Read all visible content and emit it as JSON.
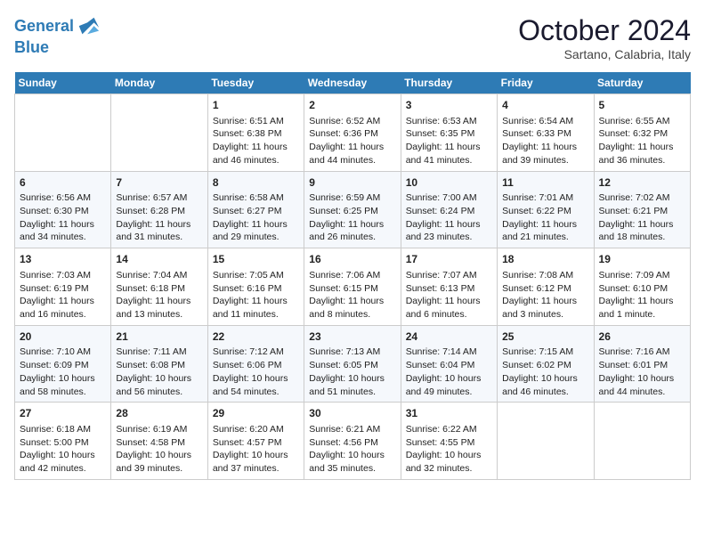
{
  "header": {
    "logo_line1": "General",
    "logo_line2": "Blue",
    "month_year": "October 2024",
    "location": "Sartano, Calabria, Italy"
  },
  "weekdays": [
    "Sunday",
    "Monday",
    "Tuesday",
    "Wednesday",
    "Thursday",
    "Friday",
    "Saturday"
  ],
  "weeks": [
    [
      {
        "day": "",
        "info": ""
      },
      {
        "day": "",
        "info": ""
      },
      {
        "day": "1",
        "info": "Sunrise: 6:51 AM\nSunset: 6:38 PM\nDaylight: 11 hours and 46 minutes."
      },
      {
        "day": "2",
        "info": "Sunrise: 6:52 AM\nSunset: 6:36 PM\nDaylight: 11 hours and 44 minutes."
      },
      {
        "day": "3",
        "info": "Sunrise: 6:53 AM\nSunset: 6:35 PM\nDaylight: 11 hours and 41 minutes."
      },
      {
        "day": "4",
        "info": "Sunrise: 6:54 AM\nSunset: 6:33 PM\nDaylight: 11 hours and 39 minutes."
      },
      {
        "day": "5",
        "info": "Sunrise: 6:55 AM\nSunset: 6:32 PM\nDaylight: 11 hours and 36 minutes."
      }
    ],
    [
      {
        "day": "6",
        "info": "Sunrise: 6:56 AM\nSunset: 6:30 PM\nDaylight: 11 hours and 34 minutes."
      },
      {
        "day": "7",
        "info": "Sunrise: 6:57 AM\nSunset: 6:28 PM\nDaylight: 11 hours and 31 minutes."
      },
      {
        "day": "8",
        "info": "Sunrise: 6:58 AM\nSunset: 6:27 PM\nDaylight: 11 hours and 29 minutes."
      },
      {
        "day": "9",
        "info": "Sunrise: 6:59 AM\nSunset: 6:25 PM\nDaylight: 11 hours and 26 minutes."
      },
      {
        "day": "10",
        "info": "Sunrise: 7:00 AM\nSunset: 6:24 PM\nDaylight: 11 hours and 23 minutes."
      },
      {
        "day": "11",
        "info": "Sunrise: 7:01 AM\nSunset: 6:22 PM\nDaylight: 11 hours and 21 minutes."
      },
      {
        "day": "12",
        "info": "Sunrise: 7:02 AM\nSunset: 6:21 PM\nDaylight: 11 hours and 18 minutes."
      }
    ],
    [
      {
        "day": "13",
        "info": "Sunrise: 7:03 AM\nSunset: 6:19 PM\nDaylight: 11 hours and 16 minutes."
      },
      {
        "day": "14",
        "info": "Sunrise: 7:04 AM\nSunset: 6:18 PM\nDaylight: 11 hours and 13 minutes."
      },
      {
        "day": "15",
        "info": "Sunrise: 7:05 AM\nSunset: 6:16 PM\nDaylight: 11 hours and 11 minutes."
      },
      {
        "day": "16",
        "info": "Sunrise: 7:06 AM\nSunset: 6:15 PM\nDaylight: 11 hours and 8 minutes."
      },
      {
        "day": "17",
        "info": "Sunrise: 7:07 AM\nSunset: 6:13 PM\nDaylight: 11 hours and 6 minutes."
      },
      {
        "day": "18",
        "info": "Sunrise: 7:08 AM\nSunset: 6:12 PM\nDaylight: 11 hours and 3 minutes."
      },
      {
        "day": "19",
        "info": "Sunrise: 7:09 AM\nSunset: 6:10 PM\nDaylight: 11 hours and 1 minute."
      }
    ],
    [
      {
        "day": "20",
        "info": "Sunrise: 7:10 AM\nSunset: 6:09 PM\nDaylight: 10 hours and 58 minutes."
      },
      {
        "day": "21",
        "info": "Sunrise: 7:11 AM\nSunset: 6:08 PM\nDaylight: 10 hours and 56 minutes."
      },
      {
        "day": "22",
        "info": "Sunrise: 7:12 AM\nSunset: 6:06 PM\nDaylight: 10 hours and 54 minutes."
      },
      {
        "day": "23",
        "info": "Sunrise: 7:13 AM\nSunset: 6:05 PM\nDaylight: 10 hours and 51 minutes."
      },
      {
        "day": "24",
        "info": "Sunrise: 7:14 AM\nSunset: 6:04 PM\nDaylight: 10 hours and 49 minutes."
      },
      {
        "day": "25",
        "info": "Sunrise: 7:15 AM\nSunset: 6:02 PM\nDaylight: 10 hours and 46 minutes."
      },
      {
        "day": "26",
        "info": "Sunrise: 7:16 AM\nSunset: 6:01 PM\nDaylight: 10 hours and 44 minutes."
      }
    ],
    [
      {
        "day": "27",
        "info": "Sunrise: 6:18 AM\nSunset: 5:00 PM\nDaylight: 10 hours and 42 minutes."
      },
      {
        "day": "28",
        "info": "Sunrise: 6:19 AM\nSunset: 4:58 PM\nDaylight: 10 hours and 39 minutes."
      },
      {
        "day": "29",
        "info": "Sunrise: 6:20 AM\nSunset: 4:57 PM\nDaylight: 10 hours and 37 minutes."
      },
      {
        "day": "30",
        "info": "Sunrise: 6:21 AM\nSunset: 4:56 PM\nDaylight: 10 hours and 35 minutes."
      },
      {
        "day": "31",
        "info": "Sunrise: 6:22 AM\nSunset: 4:55 PM\nDaylight: 10 hours and 32 minutes."
      },
      {
        "day": "",
        "info": ""
      },
      {
        "day": "",
        "info": ""
      }
    ]
  ]
}
